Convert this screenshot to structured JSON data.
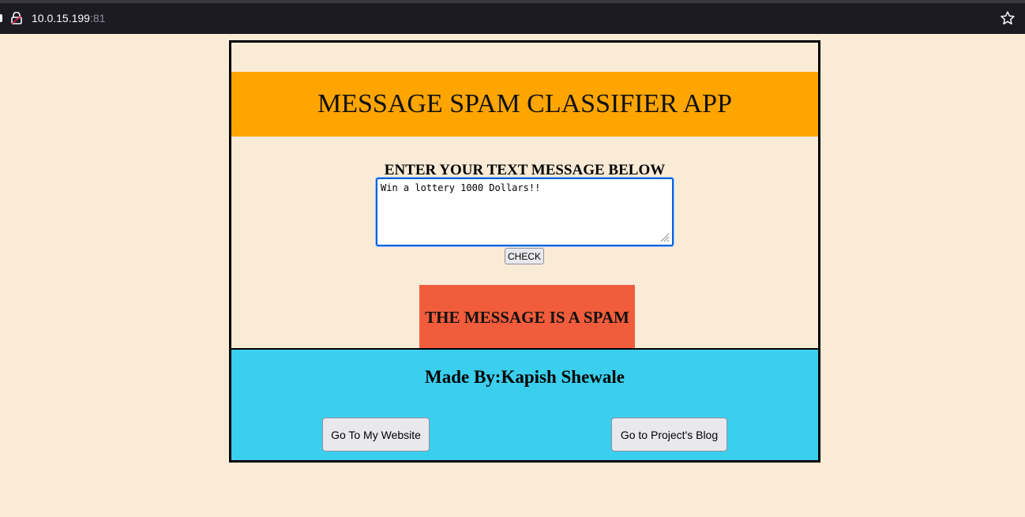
{
  "browser": {
    "url_host": "10.0.15.199",
    "url_port": ":81"
  },
  "app": {
    "title": "MESSAGE SPAM CLASSIFIER APP",
    "prompt": "ENTER YOUR TEXT MESSAGE BELOW",
    "message_value": "Win a lottery 1000 Dollars!!",
    "check_label": "CHECK",
    "result_text": "THE MESSAGE IS A SPAM"
  },
  "footer": {
    "made_by": "Made By:Kapish Shewale",
    "website_label": "Go To My Website",
    "blog_label": "Go to Project's Blog"
  },
  "colors": {
    "page_bg": "#faebd7",
    "header_bg": "#ffa500",
    "result_bg": "#f05c3c",
    "footer_bg": "#3bcfee"
  }
}
